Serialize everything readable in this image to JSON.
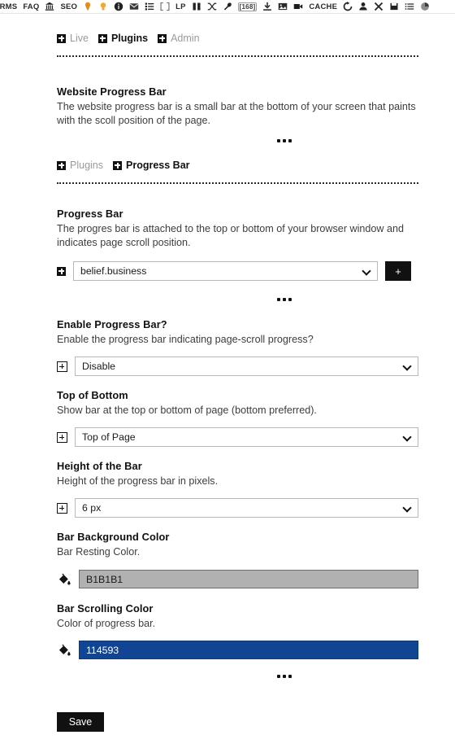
{
  "toolbar": {
    "items": [
      {
        "type": "text",
        "label": "ORMS",
        "name": "toolbar-forms"
      },
      {
        "type": "text",
        "label": "FAQ",
        "name": "toolbar-faq"
      },
      {
        "type": "icon",
        "label": "bank-icon",
        "name": "bank-icon"
      },
      {
        "type": "text",
        "label": "SEO",
        "name": "toolbar-seo"
      },
      {
        "type": "icon",
        "label": "map-pin-icon",
        "name": "map-pin-icon"
      },
      {
        "type": "icon",
        "label": "lightbulb-icon",
        "name": "lightbulb-icon"
      },
      {
        "type": "icon",
        "label": "info-circle-icon",
        "name": "info-circle-icon"
      },
      {
        "type": "icon",
        "label": "mail-icon",
        "name": "mail-icon"
      },
      {
        "type": "icon",
        "label": "list-icon",
        "name": "list-icon"
      },
      {
        "type": "icon",
        "label": "brackets-icon",
        "name": "brackets-icon"
      },
      {
        "type": "text",
        "label": "LP",
        "name": "toolbar-lp"
      },
      {
        "type": "icon",
        "label": "columns-icon",
        "name": "columns-icon"
      },
      {
        "type": "icon",
        "label": "shuffle-icon",
        "name": "shuffle-icon"
      },
      {
        "type": "icon",
        "label": "wrench-icon",
        "name": "wrench-icon"
      },
      {
        "type": "badge",
        "label": "[168]",
        "name": "count-badge"
      },
      {
        "type": "icon",
        "label": "download-icon",
        "name": "download-icon"
      },
      {
        "type": "icon",
        "label": "image-icon",
        "name": "image-icon"
      },
      {
        "type": "icon",
        "label": "video-icon",
        "name": "video-icon"
      },
      {
        "type": "text",
        "label": "CACHE",
        "name": "toolbar-cache"
      },
      {
        "type": "icon",
        "label": "refresh-icon",
        "name": "refresh-icon"
      },
      {
        "type": "icon",
        "label": "user-icon",
        "name": "user-icon"
      },
      {
        "type": "icon",
        "label": "close-icon",
        "name": "close-icon"
      },
      {
        "type": "icon",
        "label": "square-icon",
        "name": "square-icon"
      },
      {
        "type": "icon",
        "label": "checklist-icon",
        "name": "checklist-icon"
      },
      {
        "type": "icon",
        "label": "pie-icon",
        "name": "pie-icon"
      }
    ]
  },
  "breadcrumb_top": {
    "items": [
      {
        "label": "Live",
        "active": false
      },
      {
        "label": "Plugins",
        "active": true
      },
      {
        "label": "Admin",
        "active": false
      }
    ]
  },
  "intro": {
    "title": "Website Progress Bar",
    "description": "The website progress bar is a small bar at the bottom of your screen that paints with the scoll position of the page."
  },
  "breadcrumb_second": {
    "items": [
      {
        "label": "Plugins",
        "active": false
      },
      {
        "label": "Progress Bar",
        "active": true
      }
    ]
  },
  "sections": {
    "progress_bar": {
      "title": "Progress Bar",
      "description": "The progres bar is attached to the top or bottom of your browser window and indicates page scroll position.",
      "selected": "belief.business",
      "add_button": "+"
    },
    "enable": {
      "title": "Enable Progress Bar?",
      "description": "Enable the progress bar indicating page-scroll progress?",
      "selected": "Disable"
    },
    "position": {
      "title": "Top of Bottom",
      "description": "Show bar at the top or bottom of page (bottom preferred).",
      "selected": "Top of Page"
    },
    "height": {
      "title": "Height of the Bar",
      "description": "Height of the progress bar in pixels.",
      "selected": "6 px"
    },
    "bg_color": {
      "title": "Bar Background Color",
      "description": "Bar Resting Color.",
      "value": "B1B1B1",
      "swatch": "#b1b1b1",
      "text_color": "#1a1a1a"
    },
    "scroll_color": {
      "title": "Bar Scrolling Color",
      "description": "Color of progress bar.",
      "value": "114593",
      "swatch": "#114593",
      "text_color": "#ffffff"
    }
  },
  "footer": {
    "save_label": "Save"
  }
}
